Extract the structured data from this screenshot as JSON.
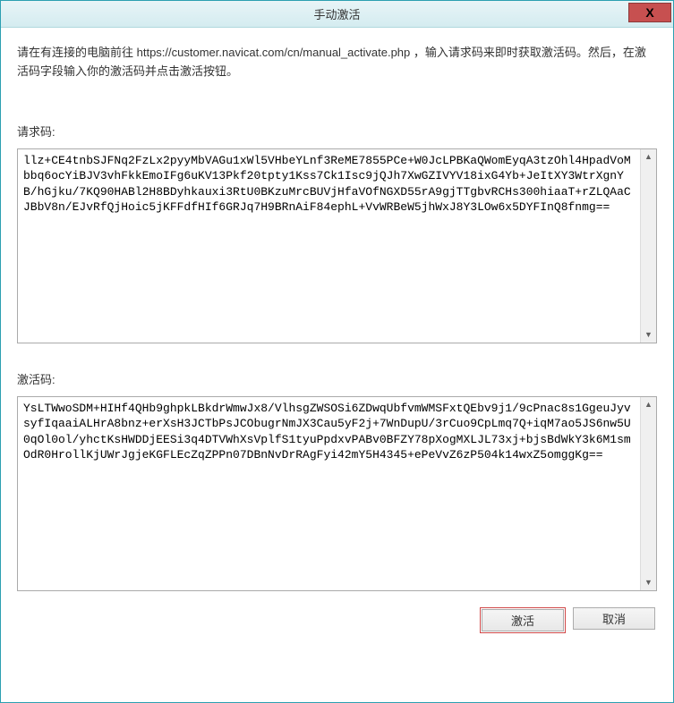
{
  "titlebar": {
    "title": "手动激活",
    "close_label": "X"
  },
  "instructions": "请在有连接的电脑前往 https://customer.navicat.com/cn/manual_activate.php ，输入请求码来即时获取激活码。然后，在激活码字段输入你的激活码并点击激活按钮。",
  "request_code": {
    "label": "请求码:",
    "value": "llz+CE4tnbSJFNq2FzLx2pyyMbVAGu1xWl5VHbeYLnf3ReME7855PCe+W0JcLPBKaQWomEyqA3tzOhl4HpadVoMbbq6ocYiBJV3vhFkkEmoIFg6uKV13Pkf20tpty1Kss7Ck1Isc9jQJh7XwGZIVYV18ixG4Yb+JeItXY3WtrXgnYB/hGjku/7KQ90HABl2H8BDyhkauxi3RtU0BKzuMrcBUVjHfaVOfNGXD55rA9gjTTgbvRCHs300hiaaT+rZLQAaCJBbV8n/EJvRfQjHoic5jKFFdfHIf6GRJq7H9BRnAiF84ephL+VvWRBeW5jhWxJ8Y3LOw6x5DYFInQ8fnmg=="
  },
  "activation_code": {
    "label": "激活码:",
    "value": "YsLTWwoSDM+HIHf4QHb9ghpkLBkdrWmwJx8/VlhsgZWSOSi6ZDwqUbfvmWMSFxtQEbv9j1/9cPnac8s1GgeuJyvsyfIqaaiALHrA8bnz+erXsH3JCTbPsJCObugrNmJX3Cau5yF2j+7WnDupU/3rCuo9CpLmq7Q+iqM7ao5JS6nw5U0qOl0ol/yhctKsHWDDjEESi3q4DTVWhXsVplfS1tyuPpdxvPABv0BFZY78pXogMXLJL73xj+bjsBdWkY3k6M1smOdR0HrollKjUWrJgjeKGFLEcZqZPPn07DBnNvDrRAgFyi42mY5H4345+ePeVvZ6zP504k14wxZ5omggKg=="
  },
  "buttons": {
    "activate": "激活",
    "cancel": "取消"
  }
}
